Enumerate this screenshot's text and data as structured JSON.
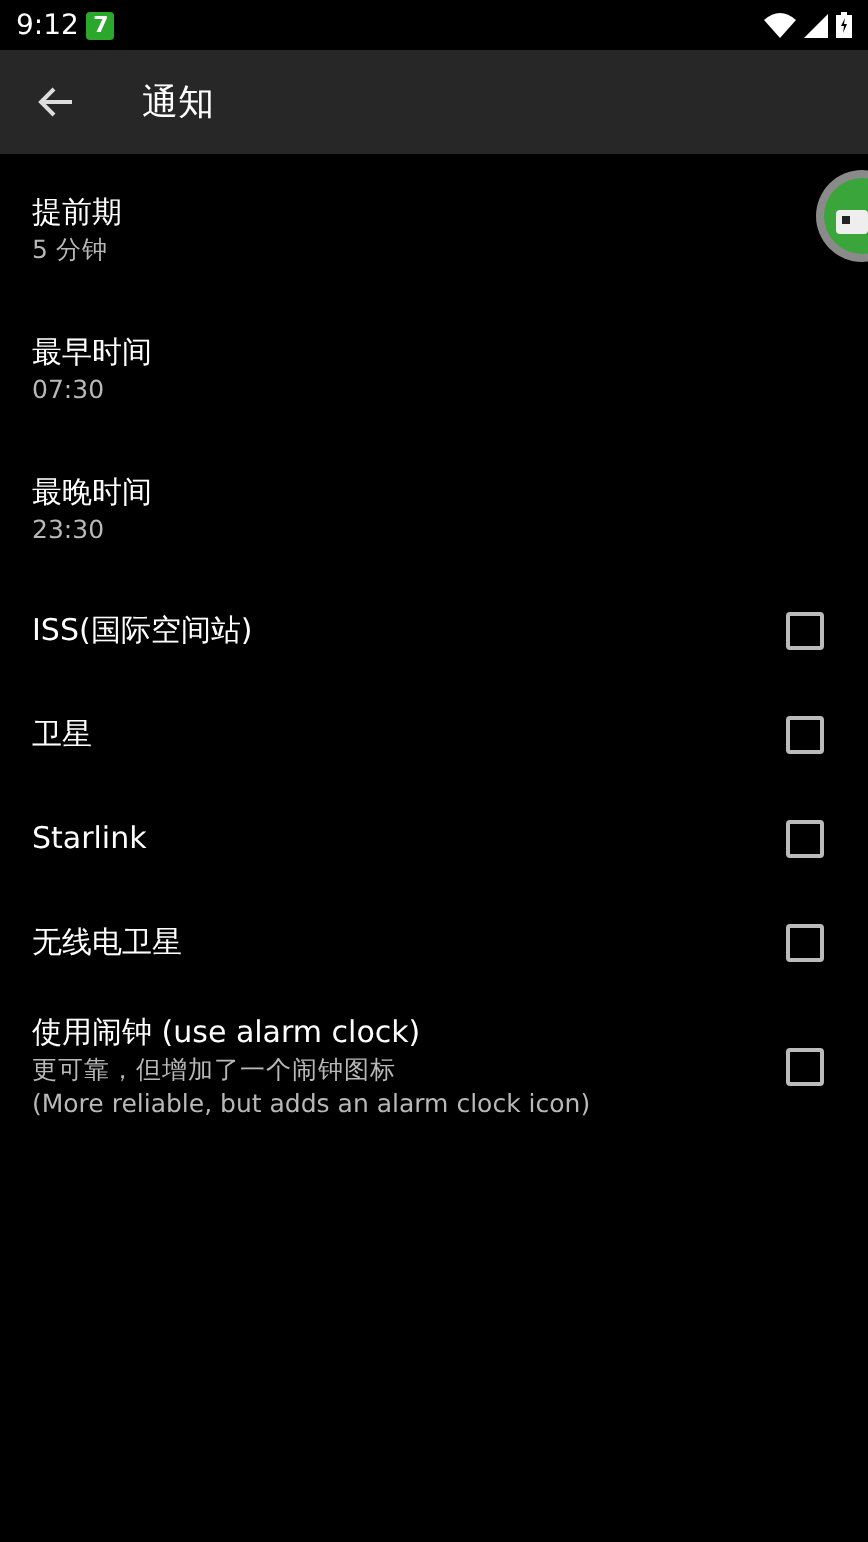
{
  "status_bar": {
    "time": "9:12",
    "badge": "7"
  },
  "toolbar": {
    "title": "通知"
  },
  "settings": [
    {
      "kind": "value",
      "title": "提前期",
      "summary": [
        "5 分钟"
      ]
    },
    {
      "kind": "value",
      "title": "最早时间",
      "summary": [
        "07:30"
      ]
    },
    {
      "kind": "value",
      "title": "最晚时间",
      "summary": [
        "23:30"
      ]
    },
    {
      "kind": "checkbox",
      "title": "ISS(国际空间站)",
      "checked": false
    },
    {
      "kind": "checkbox",
      "title": "卫星",
      "checked": false
    },
    {
      "kind": "checkbox",
      "title": "Starlink",
      "checked": false
    },
    {
      "kind": "checkbox",
      "title": "无线电卫星",
      "checked": false
    },
    {
      "kind": "checkbox",
      "title": "使用闹钟 (use alarm clock)",
      "summary": [
        "更可靠，但增加了一个闹钟图标",
        "(More reliable, but adds an alarm clock icon)"
      ],
      "checked": false
    }
  ]
}
